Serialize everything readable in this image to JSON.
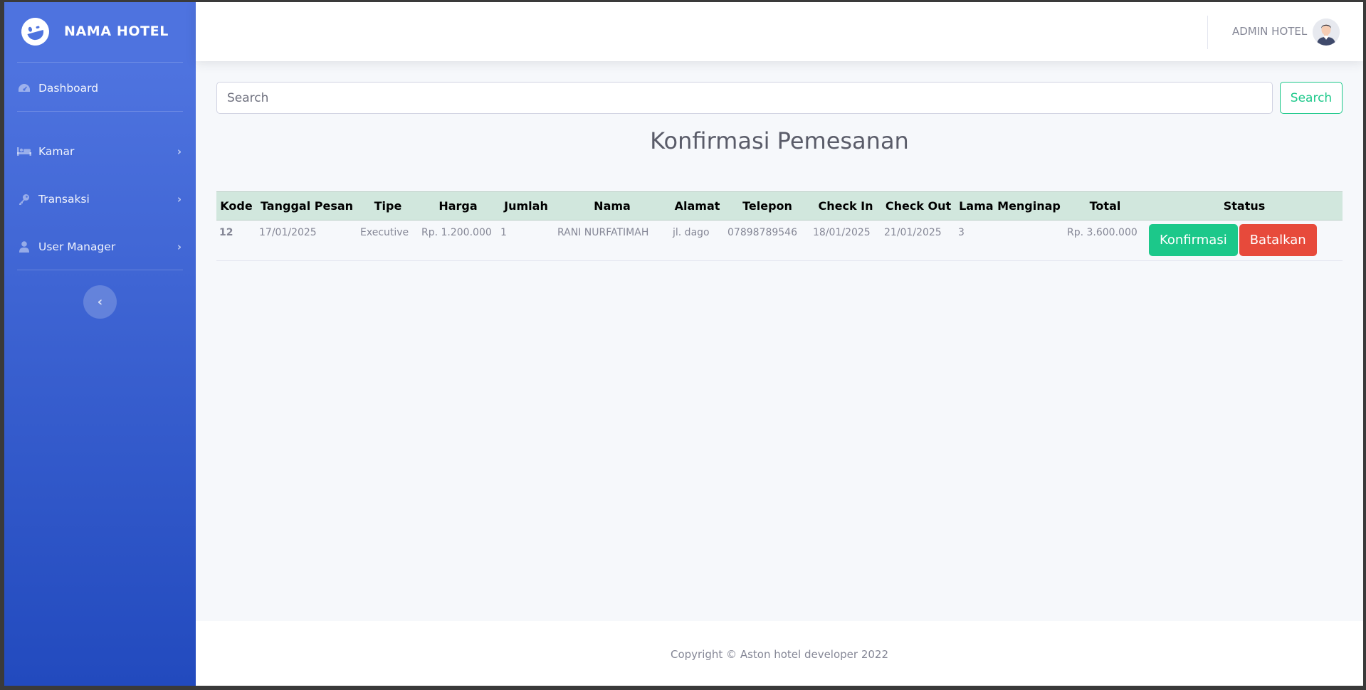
{
  "brand": {
    "name": "NAMA HOTEL",
    "logo_icon": "laugh-wink-icon"
  },
  "sidebar": {
    "items": [
      {
        "label": "Dashboard",
        "icon": "tachometer-icon"
      },
      {
        "label": "Kamar",
        "icon": "bed-icon"
      },
      {
        "label": "Transaksi",
        "icon": "key-icon"
      },
      {
        "label": "User Manager",
        "icon": "user-icon"
      }
    ],
    "toggle_icon": "chevron-left-icon"
  },
  "topbar": {
    "user_name": "ADMIN HOTEL"
  },
  "search": {
    "placeholder": "Search",
    "button_label": "Search"
  },
  "page": {
    "title": "Konfirmasi Pemesanan"
  },
  "table": {
    "headers": [
      "Kode",
      "Tanggal Pesan",
      "Tipe",
      "Harga",
      "Jumlah",
      "Nama",
      "Alamat",
      "Telepon",
      "Check In",
      "Check Out",
      "Lama Menginap",
      "Total",
      "Status"
    ],
    "rows": [
      {
        "kode": "12",
        "tanggal_pesan": "17/01/2025",
        "tipe": "Executive",
        "harga": "Rp. 1.200.000",
        "jumlah": "1",
        "nama": "RANI NURFATIMAH",
        "alamat": "jl. dago",
        "telepon": "07898789546",
        "check_in": "18/01/2025",
        "check_out": "21/01/2025",
        "lama_menginap": "3",
        "total": "Rp. 3.600.000",
        "confirm_label": "Konfirmasi",
        "cancel_label": "Batalkan"
      }
    ]
  },
  "footer": {
    "text": "Copyright © Aston hotel developer 2022"
  },
  "colors": {
    "sidebar_top": "#4e73df",
    "sidebar_bottom": "#224abe",
    "success": "#1cc88a",
    "danger": "#e74a3b",
    "table_header": "#d1e7dd"
  }
}
